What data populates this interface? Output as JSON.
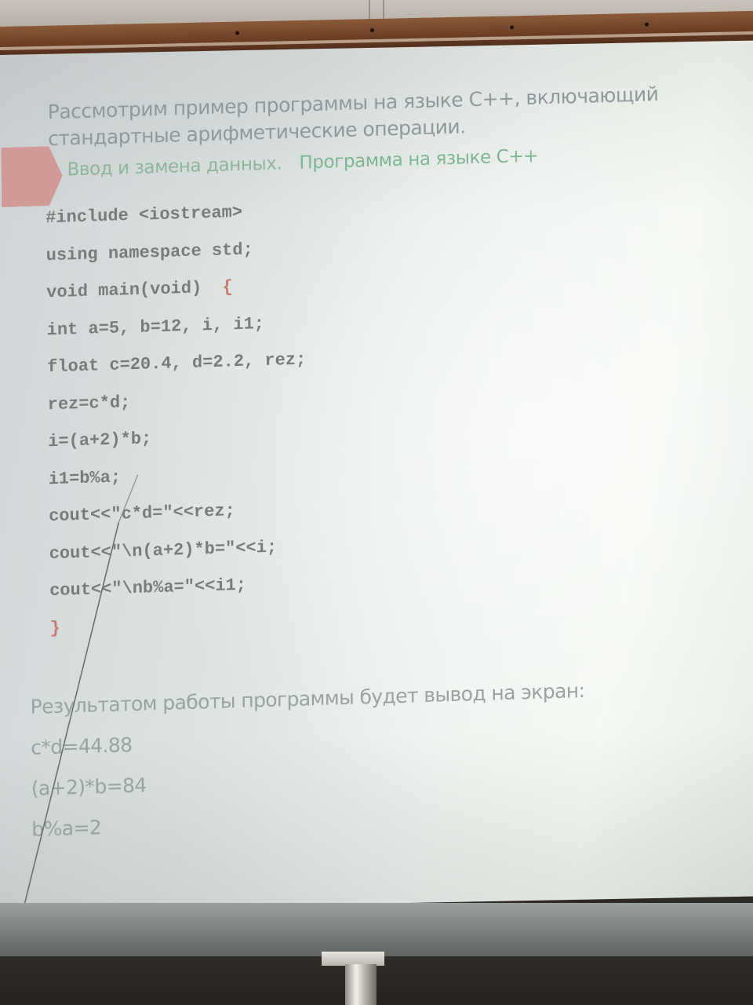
{
  "slide": {
    "intro": "Рассмотрим пример программы на языке С++, включающий стандартные арифметические операции.",
    "subheading_left": "Ввод и замена данных.",
    "subheading_right": "Программа на языке С++",
    "code_lines": [
      "#include <iostream>",
      "using namespace std;",
      "void main(void)  ",
      "int a=5, b=12, i, i1;",
      "float c=20.4, d=2.2, rez;",
      "rez=c*d;",
      "i=(a+2)*b;",
      "i1=b%a;",
      "cout<<\"c*d=\"<<rez;",
      "cout<<\"\\n(a+2)*b=\"<<i;",
      "cout<<\"\\nb%a=\"<<i1;",
      "}"
    ],
    "open_brace": "{",
    "result_heading": "Результатом работы программы будет вывод на экран:",
    "result_lines": [
      "c*d=44.88",
      "(a+2)*b=84",
      "b%a=2"
    ]
  },
  "colors": {
    "accent_shape": "#cf9a98",
    "subheading_green": "#7fb593",
    "code_gray": "#7b7b7b",
    "brace_red": "#c87a72"
  }
}
